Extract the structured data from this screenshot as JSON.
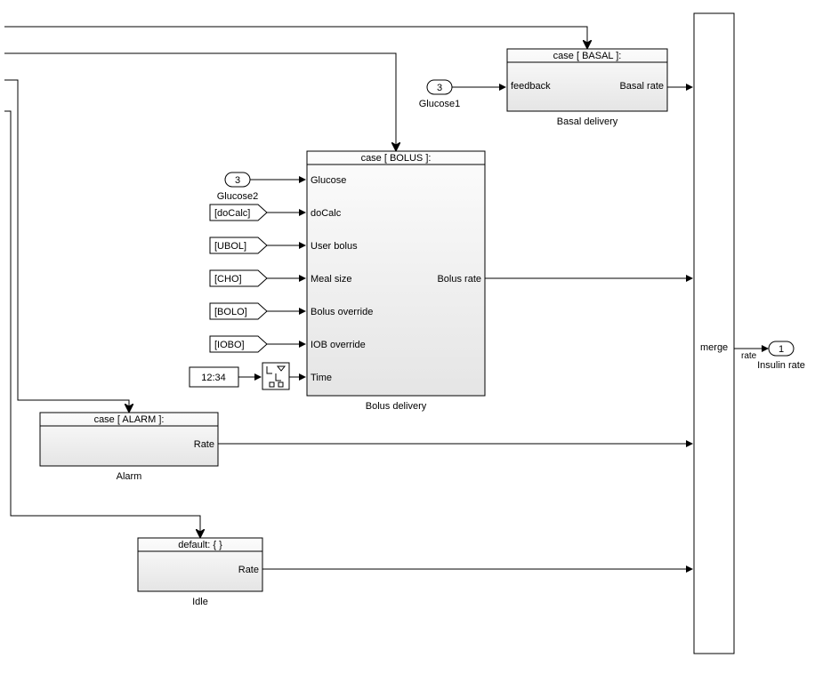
{
  "blocks": {
    "basal": {
      "header": "case [ BASAL ]:",
      "ports": {
        "in1": "feedback",
        "out1": "Basal rate"
      },
      "name": "Basal delivery"
    },
    "bolus": {
      "header": "case [ BOLUS ]:",
      "ports": {
        "in1": "Glucose",
        "in2": "doCalc",
        "in3": "User bolus",
        "in4": "Meal size",
        "in5": "Bolus override",
        "in6": "IOB override",
        "in7": "Time",
        "out1": "Bolus rate"
      },
      "name": "Bolus delivery"
    },
    "alarm": {
      "header": "case [ ALARM ]:",
      "ports": {
        "out1": "Rate"
      },
      "name": "Alarm"
    },
    "idle": {
      "header": "default: { }",
      "ports": {
        "out1": "Rate"
      },
      "name": "Idle"
    },
    "merge": {
      "label": "merge",
      "outlabel": "rate"
    },
    "outport": {
      "num": "1",
      "name": "Insulin rate"
    }
  },
  "inports": {
    "glucose1": {
      "num": "3",
      "name": "Glucose1"
    },
    "glucose2": {
      "num": "3",
      "name": "Glucose2"
    }
  },
  "from_tags": {
    "doCalc": "[doCalc]",
    "ubol": "[UBOL]",
    "cho": "[CHO]",
    "bolo": "[BOLO]",
    "iobo": "[IOBO]"
  },
  "constant": {
    "clock": "12:34"
  }
}
